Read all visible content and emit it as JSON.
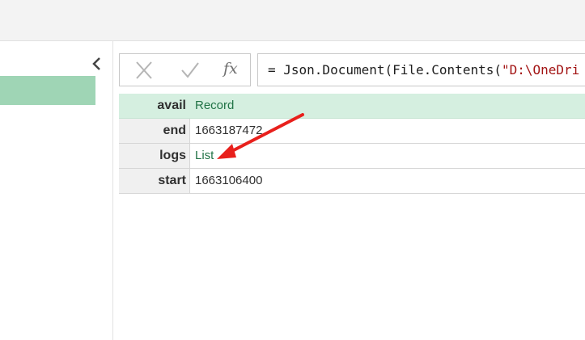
{
  "formula_bar": {
    "cancel_icon": "close-x-icon",
    "confirm_icon": "checkmark-icon",
    "fx_label": "fx",
    "formula_prefix": "= Json.Document(File.Contents(",
    "formula_string": "\"D:\\OneDri"
  },
  "sidebar": {
    "collapse_icon": "chevron-left-icon",
    "selected_color": "#9fd5b5"
  },
  "record": {
    "rows": [
      {
        "key": "avail",
        "value": "Record",
        "is_link": true
      },
      {
        "key": "end",
        "value": "1663187472",
        "is_link": false
      },
      {
        "key": "logs",
        "value": "List",
        "is_link": true
      },
      {
        "key": "start",
        "value": "1663106400",
        "is_link": false
      }
    ]
  },
  "annotation": {
    "arrow_color": "#e8201c",
    "points_to": "logs"
  },
  "colors": {
    "selected_row": "#d5efe0",
    "link_text": "#217346"
  }
}
